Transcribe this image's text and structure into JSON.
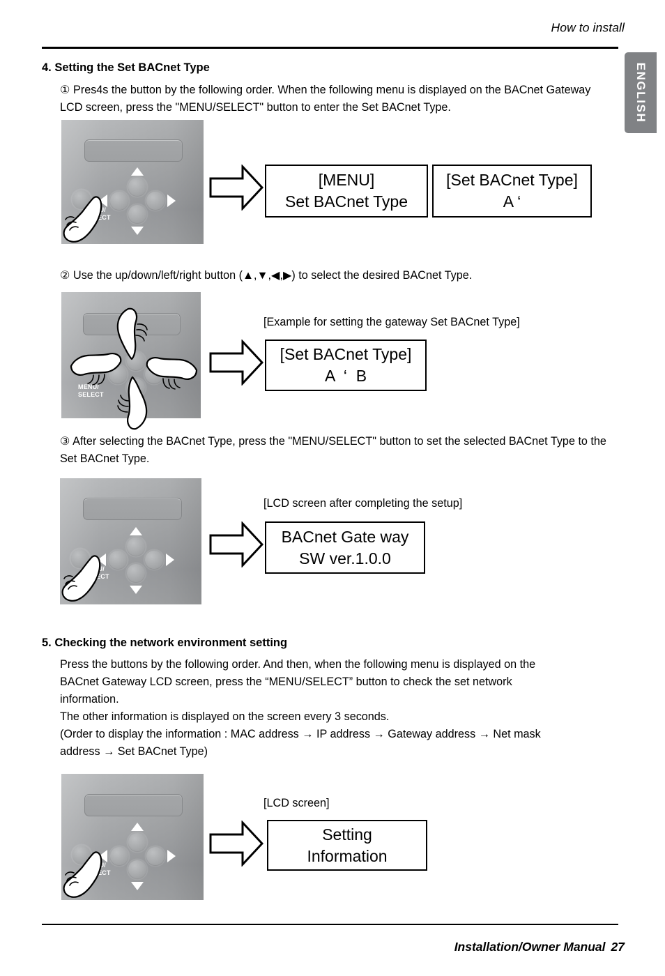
{
  "header": {
    "title": "How to install",
    "lang_tab": "ENGLISH"
  },
  "sections": [
    {
      "number_heading": "4. Setting the Set BACnet Type",
      "steps": [
        {
          "marker": "①",
          "text": "Pres4s the button by the following order. When the following menu is displayed on the BACnet Gateway LCD screen, press the \"MENU/SELECT\" button to enter the Set BACnet Type."
        },
        {
          "marker": "②",
          "text": "Use the up/down/left/right button (▲,▼,◀,▶) to select the desired BACnet Type."
        },
        {
          "marker": "③",
          "text": "After selecting the BACnet Type, press the \"MENU/SELECT\" button to set the selected BACnet Type to the Set BACnet Type."
        }
      ]
    },
    {
      "number_heading": "5. Checking the network environment setting",
      "body_lines": [
        "Press the buttons by the following order. And then, when the following menu is displayed on the",
        "BACnet Gateway LCD screen, press the “MENU/SELECT” button to check the set network",
        "information.",
        "The other information is displayed on the screen every 3 seconds.",
        "(Order to display the information : MAC address → IP address → Gateway address → Net mask",
        "address → Set BACnet Type)"
      ]
    }
  ],
  "captions": {
    "example_setting": "[Example for setting the gateway Set BACnet Type]",
    "lcd_after_setup": "[LCD screen after completing the setup]",
    "lcd_screen": "[LCD screen]"
  },
  "lcd_boxes": [
    {
      "id": "menu",
      "line1": "[MENU]",
      "line2": "Set BACnet Type"
    },
    {
      "id": "set-type-a",
      "line1": "[Set BACnet Type]",
      "line2": "A ‘"
    },
    {
      "id": "set-type-ab",
      "line1": "[Set BACnet Type]",
      "line2": "A  ‘  B"
    },
    {
      "id": "gateway-version",
      "line1": "BACnet Gate way",
      "line2": "SW ver.1.0.0"
    },
    {
      "id": "setting-information",
      "line1": "Setting",
      "line2": "Information"
    }
  ],
  "device": {
    "menu_select_label_line1": "MENU/",
    "menu_select_label_line2": "SELECT"
  },
  "footer": {
    "manual_text": "Installation/Owner Manual",
    "page_number": "27"
  },
  "colors": {
    "panel_gray": "#a9abad",
    "tab_gray": "#808285",
    "rule_black": "#000000"
  }
}
